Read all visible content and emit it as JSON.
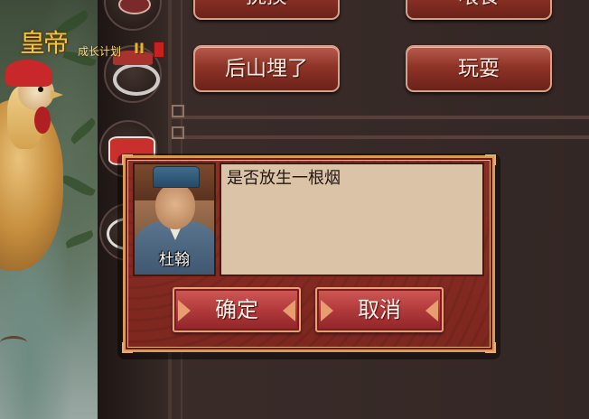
{
  "logo": {
    "title": "皇帝",
    "subtitle": "成长计划",
    "number": "II"
  },
  "options": [
    {
      "label": "抚摸"
    },
    {
      "label": "喂食"
    },
    {
      "label": "后山埋了"
    },
    {
      "label": "玩耍"
    }
  ],
  "dialog": {
    "speaker": "杜翰",
    "message": "是否放生一根烟",
    "confirm_label": "确定",
    "cancel_label": "取消"
  },
  "colors": {
    "accent_gold": "#d99a56",
    "button_red": "#b23a3b",
    "panel_dark": "#2b211f",
    "message_bg": "#dbc3a8"
  }
}
